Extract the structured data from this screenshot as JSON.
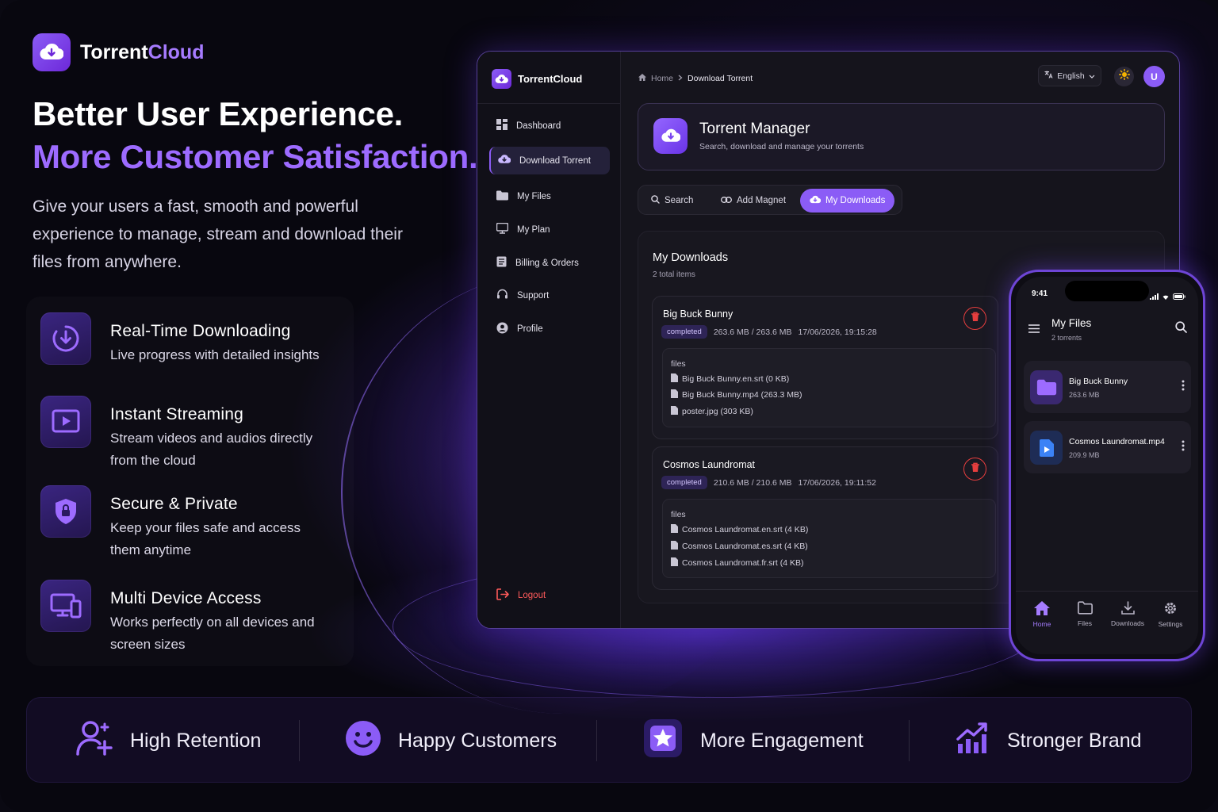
{
  "brand": {
    "name_part1": "Torrent",
    "name_part2": "Cloud"
  },
  "hero": {
    "title_line1": "Better User Experience.",
    "title_line2": "More Customer Satisfaction.",
    "subtitle": "Give your users a fast, smooth and powerful experience to manage, stream and download their files from anywhere."
  },
  "features": [
    {
      "icon": "download-clock-icon",
      "title": "Real-Time Downloading",
      "desc": "Live progress with detailed insights"
    },
    {
      "icon": "play-video-icon",
      "title": "Instant Streaming",
      "desc": "Stream videos and audios directly from the cloud"
    },
    {
      "icon": "shield-lock-icon",
      "title": "Secure & Private",
      "desc": "Keep your files safe and access them anytime"
    },
    {
      "icon": "devices-icon",
      "title": "Multi Device Access",
      "desc": "Works perfectly on all devices and screen sizes"
    }
  ],
  "stats": [
    {
      "icon": "user-plus-icon",
      "label": "High Retention"
    },
    {
      "icon": "smiley-icon",
      "label": "Happy Customers"
    },
    {
      "icon": "star-badge-icon",
      "label": "More Engagement"
    },
    {
      "icon": "growth-chart-icon",
      "label": "Stronger Brand"
    }
  ],
  "desktop": {
    "brand": "TorrentCloud",
    "sidebar": [
      {
        "icon": "dashboard-icon",
        "label": "Dashboard"
      },
      {
        "icon": "cloud-download-icon",
        "label": "Download Torrent",
        "active": true
      },
      {
        "icon": "folder-icon",
        "label": "My Files"
      },
      {
        "icon": "monitor-icon",
        "label": "My Plan"
      },
      {
        "icon": "receipt-icon",
        "label": "Billing & Orders"
      },
      {
        "icon": "headset-icon",
        "label": "Support"
      },
      {
        "icon": "user-circle-icon",
        "label": "Profile"
      }
    ],
    "logout": "Logout",
    "breadcrumb": {
      "home": "Home",
      "current": "Download Torrent"
    },
    "language": "English",
    "avatar": "U",
    "manager": {
      "title": "Torrent Manager",
      "subtitle": "Search, download and manage your torrents"
    },
    "tabs": [
      {
        "label": "Search"
      },
      {
        "label": "Add Magnet"
      },
      {
        "label": "My Downloads",
        "active": true
      }
    ],
    "downloads": {
      "title": "My Downloads",
      "count": "2 total items",
      "files_label": "files",
      "items": [
        {
          "name": "Big Buck Bunny",
          "status": "completed",
          "size": "263.6 MB / 263.6 MB",
          "date": "17/06/2026, 19:15:28",
          "files": [
            "Big Buck Bunny.en.srt (0 KB)",
            "Big Buck Bunny.mp4 (263.3 MB)",
            "poster.jpg (303 KB)"
          ]
        },
        {
          "name": "Cosmos Laundromat",
          "status": "completed",
          "size": "210.6 MB / 210.6 MB",
          "date": "17/06/2026, 19:11:52",
          "files": [
            "Cosmos Laundromat.en.srt (4 KB)",
            "Cosmos Laundromat.es.srt (4 KB)",
            "Cosmos Laundromat.fr.srt (4 KB)"
          ]
        }
      ]
    }
  },
  "phone": {
    "time": "9:41",
    "title": "My Files",
    "subtitle": "2 torrents",
    "items": [
      {
        "icon": "folder-icon",
        "name": "Big Buck Bunny",
        "size": "263.6 MB"
      },
      {
        "icon": "video-file-icon",
        "name": "Cosmos Laundromat.mp4",
        "size": "209.9 MB"
      }
    ],
    "nav": [
      {
        "icon": "home-icon",
        "label": "Home",
        "active": true
      },
      {
        "icon": "folder-icon",
        "label": "Files"
      },
      {
        "icon": "download-icon",
        "label": "Downloads"
      },
      {
        "icon": "gear-icon",
        "label": "Settings"
      }
    ]
  },
  "colors": {
    "accent": "#8b5cf6",
    "accent_light": "#a67bff",
    "danger": "#e53e3e",
    "background": "#08070f"
  }
}
